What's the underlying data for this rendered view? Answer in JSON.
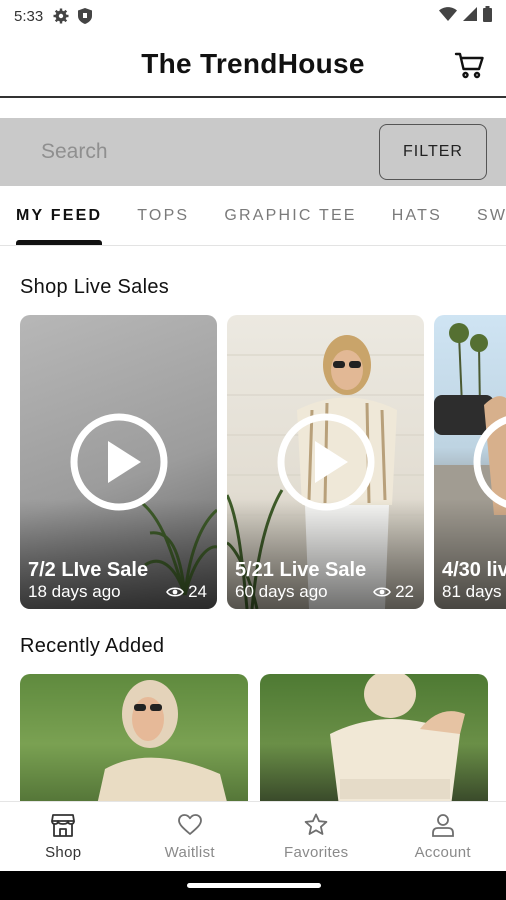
{
  "status_bar": {
    "time": "5:33",
    "icons": [
      "gear-icon",
      "shield-icon",
      "wifi-icon",
      "signal-icon",
      "battery-icon"
    ]
  },
  "header": {
    "title": "The TrendHouse",
    "cart_icon": "cart-icon"
  },
  "search": {
    "placeholder": "Search",
    "filter_label": "FILTER"
  },
  "tabs": [
    {
      "label": "MY FEED",
      "active": true
    },
    {
      "label": "TOPS",
      "active": false
    },
    {
      "label": "GRAPHIC TEE",
      "active": false
    },
    {
      "label": "HATS",
      "active": false
    },
    {
      "label": "SWE",
      "active": false
    }
  ],
  "live_sales": {
    "title": "Shop Live Sales",
    "cards": [
      {
        "title": "7/2 LIve Sale",
        "ago": "18 days ago",
        "views": "24"
      },
      {
        "title": "5/21 Live Sale",
        "ago": "60 days ago",
        "views": "22"
      },
      {
        "title": "4/30 liv",
        "ago": "81 days",
        "views": ""
      }
    ]
  },
  "recently_added": {
    "title": "Recently Added"
  },
  "bottom_nav": [
    {
      "label": "Shop",
      "icon": "shop-icon",
      "active": true
    },
    {
      "label": "Waitlist",
      "icon": "heart-icon",
      "active": false
    },
    {
      "label": "Favorites",
      "icon": "star-icon",
      "active": false
    },
    {
      "label": "Account",
      "icon": "person-icon",
      "active": false
    }
  ]
}
